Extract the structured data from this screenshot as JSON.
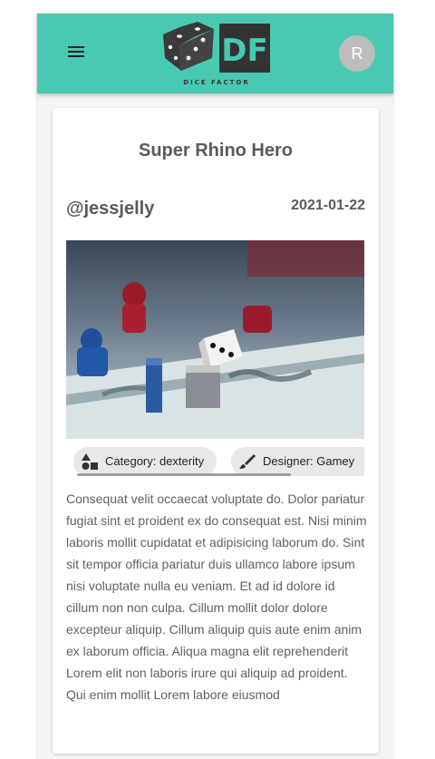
{
  "header": {
    "logo_letters": "DF",
    "logo_tagline": "DICE FACTOR",
    "avatar_initial": "R",
    "colors": {
      "bar": "#49c9b1"
    },
    "icons": {
      "menu": "menu-icon",
      "dice": "dice-icon"
    }
  },
  "post": {
    "game_title": "Super Rhino Hero",
    "username": "@jessjelly",
    "date": "2021-01-22",
    "chips": [
      {
        "label": "Category: dexterity",
        "icon": "shapes-icon"
      },
      {
        "label": "Designer: Gamey",
        "icon": "brush-icon"
      }
    ],
    "body": "Consequat velit occaecat voluptate do. Dolor pariatur fugiat sint et proident ex do consequat est. Nisi minim laboris mollit cupidatat et adipisicing laborum do. Sint sit tempor officia pariatur duis ullamco labore ipsum nisi voluptate nulla eu veniam. Et ad id dolore id cillum non non culpa. Cillum mollit dolor dolore excepteur aliquip. Cillum aliquip quis aute enim anim ex laborum officia. Aliqua magna elit reprehenderit Lorem elit non laboris irure qui aliquip ad proident. Qui enim mollit Lorem labore eiusmod"
  }
}
